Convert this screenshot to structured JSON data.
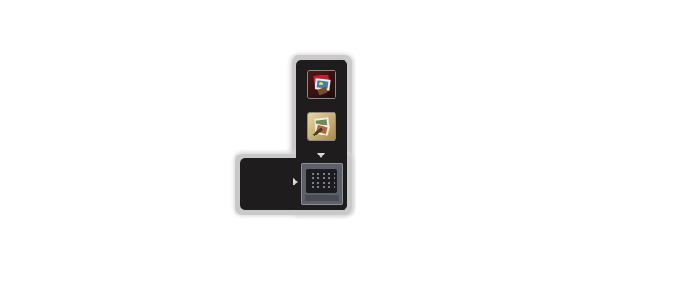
{
  "panel": {
    "name": "launcher-panel",
    "colors": {
      "shell": "#c9c9c9",
      "panel": "#1e1c1d",
      "tile_border": "#8a8a8a",
      "arrow": "#d8d8d8",
      "grid_pane": "#5d6068"
    }
  },
  "apps": [
    {
      "icon": "photo-stack-red-icon"
    },
    {
      "icon": "photo-stack-gold-icon"
    }
  ],
  "controls": {
    "expand_down": "triangle-down-icon",
    "expand_right": "triangle-right-icon"
  },
  "grid_view": {
    "icon": "app-grid-icon",
    "rows": 4,
    "cols": 5
  }
}
